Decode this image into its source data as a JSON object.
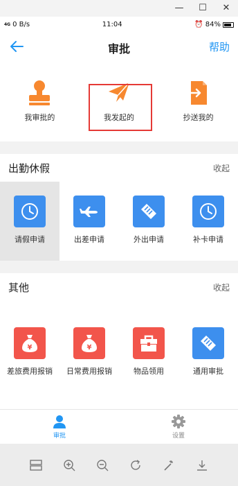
{
  "status_bar": {
    "signal": "4G",
    "network_speed": "0 B/s",
    "time": "11:04",
    "battery": "84%"
  },
  "nav": {
    "title": "审批",
    "help_label": "帮助"
  },
  "shortcuts": [
    {
      "label": "我审批的",
      "icon": "stamp-icon"
    },
    {
      "label": "我发起的",
      "icon": "paper-plane-icon"
    },
    {
      "label": "抄送我的",
      "icon": "cc-document-icon"
    }
  ],
  "attendance_section": {
    "title": "出勤休假",
    "fold_label": "收起",
    "items": [
      {
        "label": "请假申请",
        "icon": "clock-icon"
      },
      {
        "label": "出差申请",
        "icon": "airplane-icon"
      },
      {
        "label": "外出申请",
        "icon": "handshake-icon"
      },
      {
        "label": "补卡申请",
        "icon": "clock-icon"
      }
    ]
  },
  "other_section": {
    "title": "其他",
    "fold_label": "收起",
    "items": [
      {
        "label": "差旅费用报销",
        "icon": "money-bag-icon"
      },
      {
        "label": "日常费用报销",
        "icon": "money-bag-icon"
      },
      {
        "label": "物品领用",
        "icon": "toolbox-icon"
      },
      {
        "label": "通用审批",
        "icon": "handshake-icon"
      }
    ]
  },
  "tabbar": {
    "approval_label": "审批",
    "settings_label": "设置"
  },
  "colors": {
    "accent": "#2196f3",
    "orange": "#f7882f",
    "tile_blue": "#3d8fee",
    "tile_red": "#f2554b",
    "highlight": "#e53935"
  }
}
